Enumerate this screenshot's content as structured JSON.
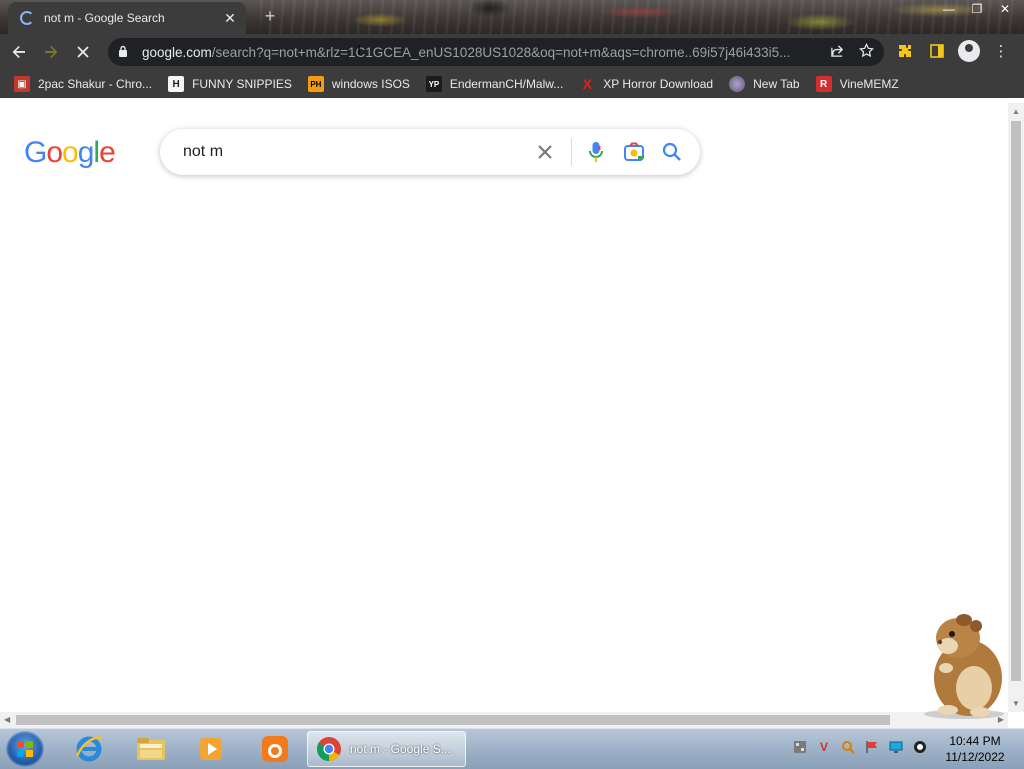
{
  "browser": {
    "tab": {
      "title": "not m - Google Search"
    },
    "window_controls": {
      "minimize": "—",
      "restore": "❐",
      "close": "✕"
    },
    "url": {
      "host": "google.com",
      "path": "/search?q=not+m&rlz=1C1GCEA_enUS1028US1028&oq=not+m&aqs=chrome..69i57j46i433i5..."
    },
    "bookmarks": [
      {
        "label": "2pac Shakur - Chro...",
        "icon": "gift-icon",
        "color": "#c0392b"
      },
      {
        "label": "FUNNY SNIPPIES",
        "icon": "h-icon",
        "badge": "H",
        "color": "#222222"
      },
      {
        "label": "windows ISOS",
        "icon": "ph-icon",
        "badge": "PH",
        "color": "#f39c12"
      },
      {
        "label": "EndermanCH/Malw...",
        "icon": "yp-icon",
        "badge": "YP",
        "color": "#1b1b1b"
      },
      {
        "label": "XP Horror Download",
        "icon": "x-icon",
        "badge": "X",
        "color": "#e0201e"
      },
      {
        "label": "New Tab",
        "icon": "globe-icon",
        "color": "#6d6d6d"
      },
      {
        "label": "VineMEMZ",
        "icon": "r-icon",
        "badge": "R",
        "color": "#d32f2f"
      }
    ]
  },
  "google": {
    "logo_letters": [
      "G",
      "o",
      "o",
      "g",
      "l",
      "e"
    ],
    "search_value": "not m"
  },
  "taskbar": {
    "active_window_label": "not m - Google S...",
    "clock_time": "10:44 PM",
    "clock_date": "11/12/2022"
  }
}
